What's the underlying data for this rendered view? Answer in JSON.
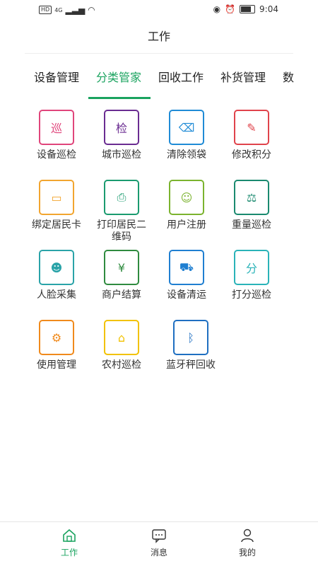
{
  "status": {
    "network_label": "4G",
    "hd_label": "HD",
    "time": "9:04"
  },
  "header": {
    "title": "工作"
  },
  "tabs": [
    {
      "label": "设备管理",
      "active": false
    },
    {
      "label": "分类管家",
      "active": true
    },
    {
      "label": "回收工作",
      "active": false
    },
    {
      "label": "补货管理",
      "active": false
    },
    {
      "label": "数",
      "active": false
    }
  ],
  "grid": [
    {
      "label": "设备巡检",
      "icon": "device-inspection-icon",
      "color": "#e0457b",
      "glyph": "巡"
    },
    {
      "label": "城市巡检",
      "icon": "city-inspection-icon",
      "color": "#6a2c91",
      "glyph": "检"
    },
    {
      "label": "清除领袋",
      "icon": "eraser-icon",
      "color": "#1f8bd6",
      "glyph": "⌫"
    },
    {
      "label": "修改积分",
      "icon": "edit-points-icon",
      "color": "#e0434b",
      "glyph": "✎"
    },
    {
      "label": "绑定居民卡",
      "icon": "bind-card-icon",
      "color": "#f2a52f",
      "glyph": "▭"
    },
    {
      "label": "打印居民二维码",
      "icon": "printer-icon",
      "color": "#1a9b6f",
      "glyph": "⎙"
    },
    {
      "label": "用户注册",
      "icon": "user-register-icon",
      "color": "#7bb32e",
      "glyph": "☺"
    },
    {
      "label": "重量巡检",
      "icon": "scale-icon",
      "color": "#1a8a6f",
      "glyph": "⚖"
    },
    {
      "label": "人脸采集",
      "icon": "face-capture-icon",
      "color": "#2aa3a8",
      "glyph": "☻"
    },
    {
      "label": "商户结算",
      "icon": "merchant-settlement-icon",
      "color": "#2f8b3f",
      "glyph": "¥"
    },
    {
      "label": "设备清运",
      "icon": "truck-icon",
      "color": "#1f7fd1",
      "glyph": "⛟"
    },
    {
      "label": "打分巡检",
      "icon": "score-inspection-icon",
      "color": "#2ab3b8",
      "glyph": "分"
    },
    {
      "label": "使用管理",
      "icon": "usage-management-icon",
      "color": "#f08a1c",
      "glyph": "⚙"
    },
    {
      "label": "农村巡检",
      "icon": "rural-inspection-icon",
      "color": "#f2c200",
      "glyph": "⌂"
    },
    {
      "label": "蓝牙秤回收",
      "icon": "bluetooth-scale-icon",
      "color": "#1f6fc1",
      "glyph": "ᛒ"
    }
  ],
  "tabbar": [
    {
      "label": "工作",
      "icon": "home-icon",
      "active": true
    },
    {
      "label": "消息",
      "icon": "message-icon",
      "active": false
    },
    {
      "label": "我的",
      "icon": "profile-icon",
      "active": false
    }
  ]
}
